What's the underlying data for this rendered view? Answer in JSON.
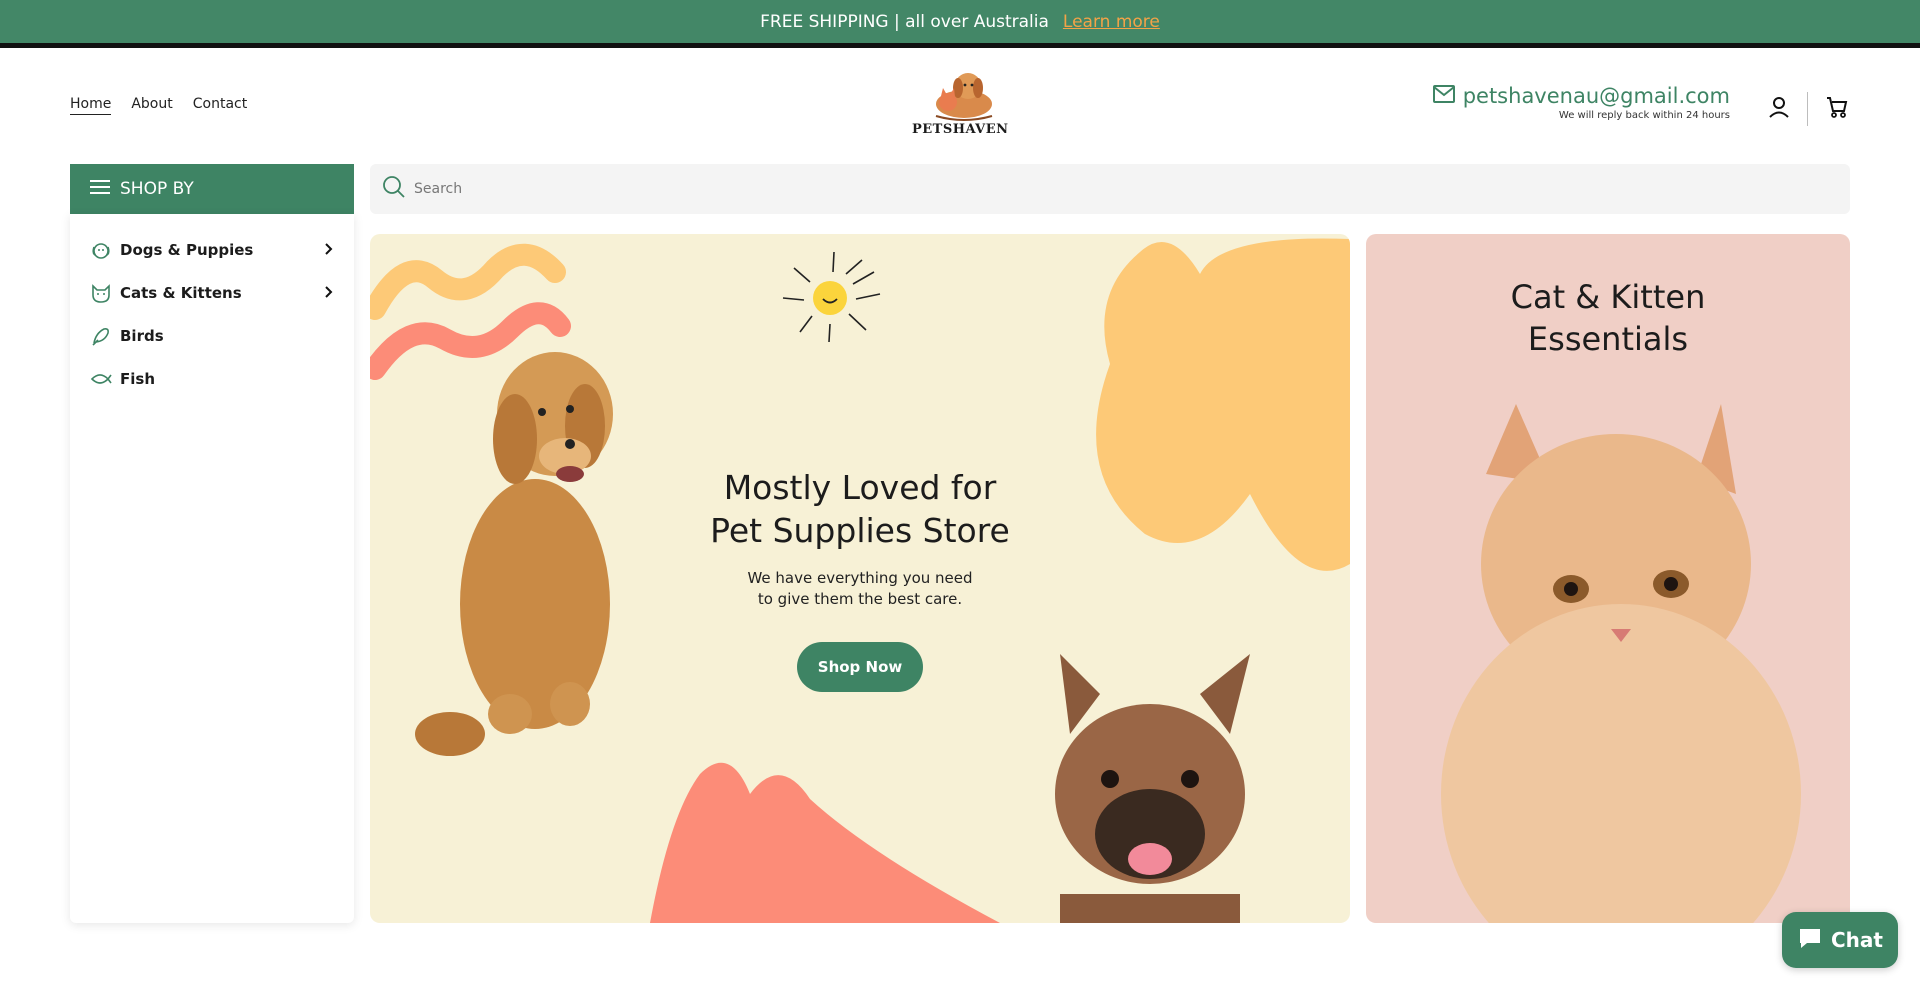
{
  "announcement": {
    "text": "FREE SHIPPING | all over Australia",
    "link": "Learn more"
  },
  "nav": {
    "items": [
      {
        "label": "Home",
        "active": true
      },
      {
        "label": "About",
        "active": false
      },
      {
        "label": "Contact",
        "active": false
      }
    ]
  },
  "brand": {
    "name": "PETSHAVEN"
  },
  "contact": {
    "email": "petshavenau@gmail.com",
    "reply_note": "We will reply back within 24 hours"
  },
  "sidebar": {
    "header": "SHOP BY",
    "items": [
      {
        "label": "Dogs & Puppies",
        "icon": "dog-icon",
        "has_submenu": true
      },
      {
        "label": "Cats & Kittens",
        "icon": "cat-icon",
        "has_submenu": true
      },
      {
        "label": "Birds",
        "icon": "bird-icon",
        "has_submenu": false
      },
      {
        "label": "Fish",
        "icon": "fish-icon",
        "has_submenu": false
      }
    ]
  },
  "search": {
    "placeholder": "Search"
  },
  "hero": {
    "title_line1": "Mostly Loved for",
    "title_line2": "Pet Supplies Store",
    "subtitle_line1": "We have everything you need",
    "subtitle_line2": "to give them the best care.",
    "button": "Shop Now"
  },
  "promo": {
    "title_line1": "Cat & Kitten",
    "title_line2": "Essentials"
  },
  "chat": {
    "label": "Chat"
  },
  "colors": {
    "brand_green": "#3e8464",
    "announce_green": "#438767",
    "accent_orange": "#f3a347",
    "hero_bg": "#f7f1d6",
    "promo_bg": "#f0cfc6",
    "blob_yellow": "#fdc977",
    "blob_coral": "#fc8c78"
  }
}
